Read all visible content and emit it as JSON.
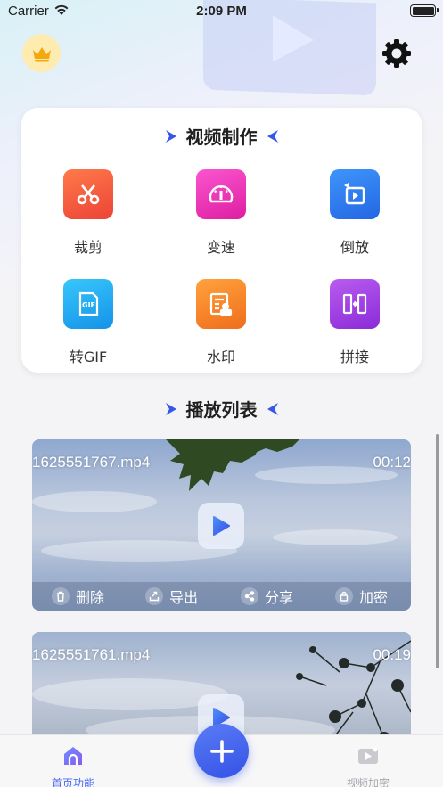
{
  "status_bar": {
    "carrier": "Carrier",
    "time": "2:09 PM"
  },
  "video_making": {
    "title": "视频制作",
    "tools": [
      {
        "label": "裁剪",
        "icon": "scissors-icon",
        "color": "#f2573c"
      },
      {
        "label": "变速",
        "icon": "speedometer-icon",
        "color": "#ec2fb3"
      },
      {
        "label": "倒放",
        "icon": "rewind-play-icon",
        "color": "#2f7cf0"
      },
      {
        "label": "转GIF",
        "icon": "gif-icon",
        "color": "#1fa7ee"
      },
      {
        "label": "水印",
        "icon": "watermark-icon",
        "color": "#f5822a"
      },
      {
        "label": "拼接",
        "icon": "merge-icon",
        "color": "#9b3ae0"
      }
    ]
  },
  "playlist": {
    "title": "播放列表",
    "videos": [
      {
        "name": "1625551767.mp4",
        "duration": "00:12",
        "actions": [
          {
            "label": "删除",
            "icon": "trash-icon"
          },
          {
            "label": "导出",
            "icon": "export-icon"
          },
          {
            "label": "分享",
            "icon": "share-icon"
          },
          {
            "label": "加密",
            "icon": "lock-icon"
          }
        ]
      },
      {
        "name": "1625551761.mp4",
        "duration": "00:19"
      }
    ]
  },
  "tabbar": {
    "home_label": "首页功能",
    "encrypt_label": "视频加密",
    "active_color": "#4a6cf2",
    "inactive_color": "#a8a8ae"
  }
}
